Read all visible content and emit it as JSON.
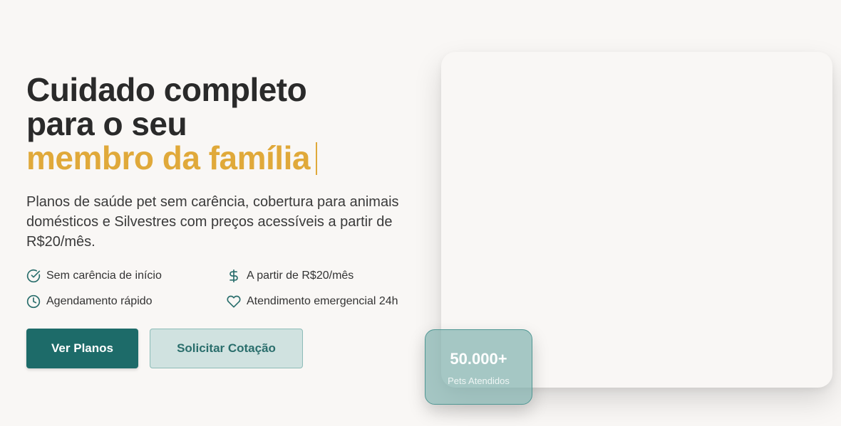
{
  "hero": {
    "headline_line1": "Cuidado completo",
    "headline_line2": "para o seu",
    "headline_accent": "membro da família",
    "subtitle": "Planos de saúde pet sem carência, cobertura para animais domésticos e Silvestres com preços acessíveis a partir de R$20/mês."
  },
  "features": [
    {
      "icon": "check-circle-icon",
      "label": "Sem carência de início"
    },
    {
      "icon": "dollar-icon",
      "label": "A partir de R$20/mês"
    },
    {
      "icon": "clock-icon",
      "label": "Agendamento rápido"
    },
    {
      "icon": "heart-icon",
      "label": "Atendimento emergencial 24h"
    }
  ],
  "buttons": {
    "primary_label": "Ver Planos",
    "secondary_label": "Solicitar Cotação"
  },
  "stat": {
    "value": "50.000+",
    "label": "Pets Atendidos"
  },
  "colors": {
    "accent": "#e0a93a",
    "primary": "#1d6b69",
    "secondary_bg": "#d0e2e0",
    "icon": "#2a6e6c",
    "background": "#f9f7f5"
  }
}
